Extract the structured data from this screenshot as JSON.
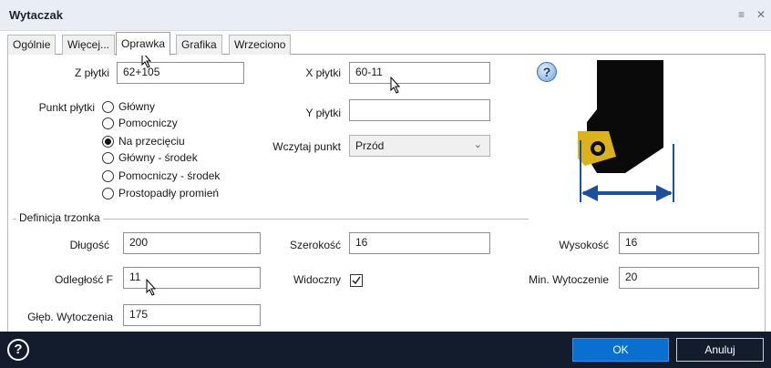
{
  "window": {
    "title": "Wytaczak",
    "menu_icon": "menu-icon",
    "close_icon": "close-icon"
  },
  "tabs": [
    {
      "label": "Ogólnie"
    },
    {
      "label": "Więcej..."
    },
    {
      "label": "Oprawka"
    },
    {
      "label": "Grafika"
    },
    {
      "label": "Wrzeciono"
    }
  ],
  "insert": {
    "z_label": "Z płytki",
    "z_value": "62+105",
    "x_label": "X płytki",
    "x_value": "60-11",
    "y_label": "Y płytki",
    "y_value": "",
    "point_label": "Punkt płytki",
    "point_options": [
      "Główny",
      "Pomocniczy",
      "Na przecięciu",
      "Główny - środek",
      "Pomocniczy - środek",
      "Prostopadły promień"
    ],
    "point_selected": "Na przecięciu",
    "load_label": "Wczytaj punkt",
    "load_value": "Przód"
  },
  "shank": {
    "group_title": "Definicja trzonka",
    "length_label": "Długość",
    "length_value": "200",
    "width_label": "Szerokość",
    "width_value": "16",
    "height_label": "Wysokość",
    "height_value": "16",
    "offset_label": "Odległość F",
    "offset_value": "11",
    "visible_label": "Widoczny",
    "visible_checked": true,
    "min_bore_label": "Min. Wytoczenie",
    "min_bore_value": "20",
    "bore_depth_label": "Głęb. Wytoczenia",
    "bore_depth_value": "175"
  },
  "footer": {
    "help_label": "?",
    "ok_label": "OK",
    "cancel_label": "Anuluj"
  },
  "colors": {
    "accent": "#0b6fd0",
    "footer_bg": "#121c2c",
    "dimension_blue": "#1d4fa0",
    "insert_gold": "#d9b21e"
  }
}
